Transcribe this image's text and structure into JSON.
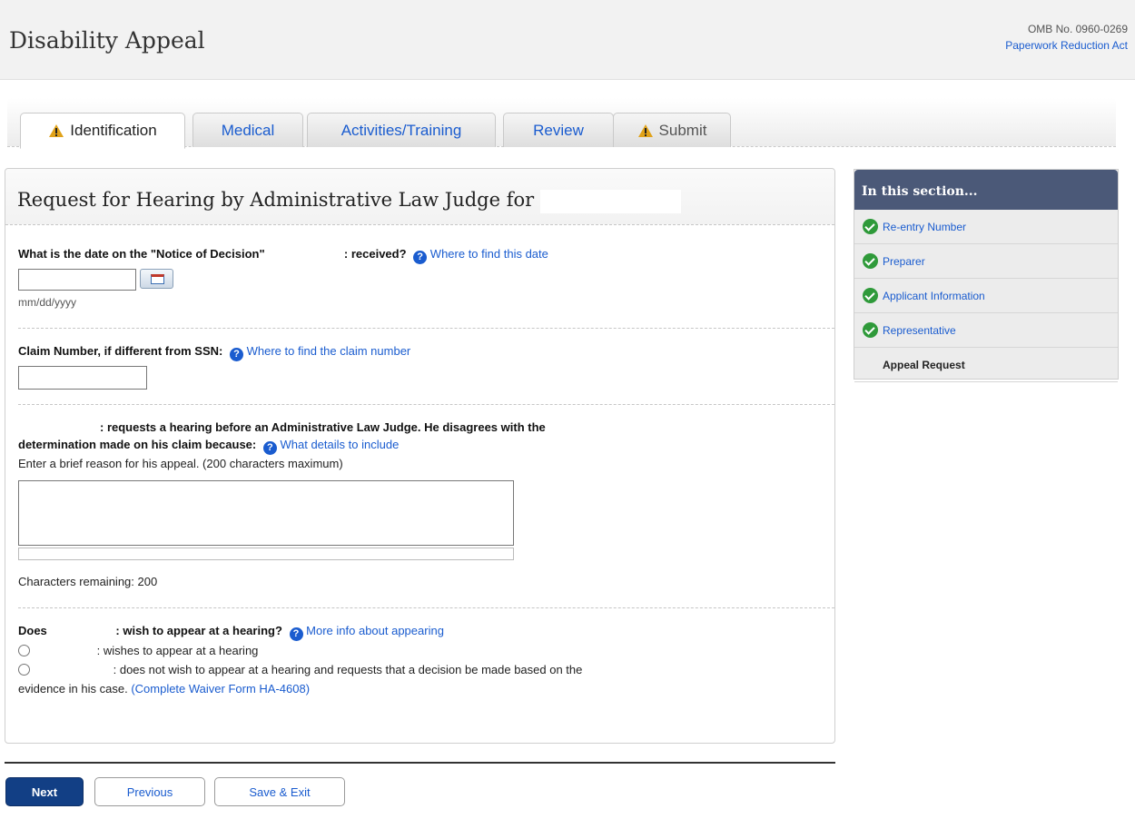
{
  "header": {
    "title": "Disability Appeal",
    "omb": "OMB No. 0960-0269",
    "paperwork_link": "Paperwork Reduction Act"
  },
  "tabs": [
    {
      "label": "Identification"
    },
    {
      "label": "Medical"
    },
    {
      "label": "Activities/Training"
    },
    {
      "label": "Review"
    },
    {
      "label": "Submit"
    }
  ],
  "panel": {
    "title": "Request for Hearing by Administrative Law Judge for"
  },
  "q_date": {
    "label_pre": "What is the date on the \"Notice of Decision\"",
    "label_post": ": received?",
    "help_link": "Where to find this date",
    "input_value": "",
    "format_hint": "mm/dd/yyyy"
  },
  "q_claim": {
    "label": "Claim Number, if different from SSN:",
    "help_link": "Where to find the claim number",
    "input_value": ""
  },
  "q_reason": {
    "label_line1": ": requests a hearing before an Administrative Law Judge. He disagrees with the",
    "label_line2": "determination made on his claim because:",
    "help_link": "What details to include",
    "instruction": "Enter a brief reason for his appeal. (200 characters maximum)",
    "textarea_value": "",
    "remaining_label": "Characters remaining:",
    "remaining_count": "200"
  },
  "q_appear": {
    "label_pre": "Does",
    "label_post": ": wish to appear at a hearing?",
    "help_link": "More info about appearing",
    "option1": ": wishes to appear at a hearing",
    "option2_line1": ": does not wish to appear at a hearing and requests that a decision be made based on the",
    "option2_line2": "evidence in his case.",
    "waiver_link": "(Complete Waiver Form HA-4608)"
  },
  "sidebar": {
    "title": "In this section...",
    "items": [
      {
        "label": "Re-entry Number"
      },
      {
        "label": "Preparer"
      },
      {
        "label": "Applicant Information"
      },
      {
        "label": "Representative"
      },
      {
        "label": "Appeal Request"
      }
    ]
  },
  "buttons": {
    "next": "Next",
    "previous": "Previous",
    "save_exit": "Save & Exit"
  },
  "colors": {
    "link": "#1a5ccf",
    "primary_button": "#123f85",
    "sidebar_header": "#4b5978",
    "check": "#2f9a3a",
    "warning": "#e0a21a"
  }
}
